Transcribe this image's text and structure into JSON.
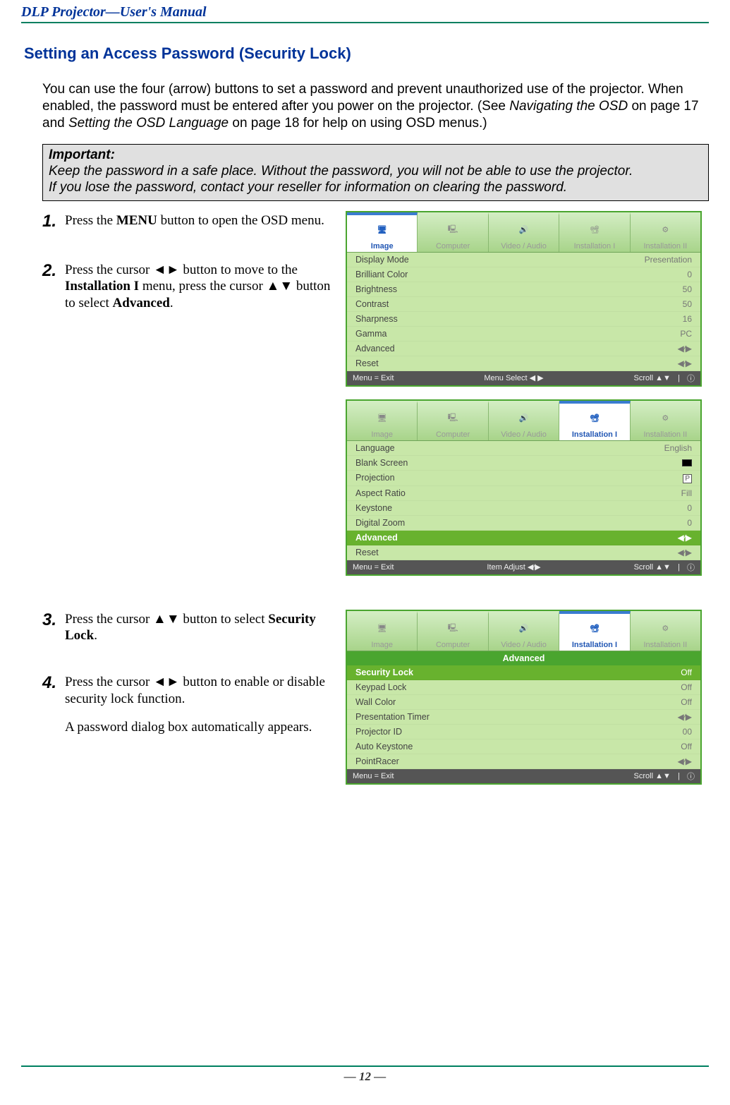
{
  "doc": {
    "header": "DLP Projector—User's Manual",
    "section_heading": "Setting an Access Password (Security Lock)",
    "intro_part1": "You can use the four (arrow) buttons to set a password and prevent unauthorized use of the projector. When enabled, the password must be entered after you power on the projector. (See ",
    "intro_italic1": "Navigating the OSD",
    "intro_part2": " on page 17 and ",
    "intro_italic2": "Setting the OSD Language",
    "intro_part3": " on page 18 for help on using OSD menus.)",
    "note_title": "Important:",
    "note_line1": "Keep the password in a safe place. Without the password, you will not be able to use the projector.",
    "note_line2": "If you lose the password, contact your reseller for information on clearing the password.",
    "steps": {
      "s1_num": "1.",
      "s1_a": "Press the ",
      "s1_b": "MENU",
      "s1_c": " button to open the OSD menu.",
      "s2_num": "2.",
      "s2_a": "Press the cursor ◄► button to move to the ",
      "s2_b": "Installation I",
      "s2_c": " menu, press the cursor ▲▼ button to select ",
      "s2_d": "Advanced",
      "s2_e": ".",
      "s3_num": "3.",
      "s3_a": "Press the cursor ▲▼ button to select ",
      "s3_b": "Security Lock",
      "s3_c": ".",
      "s4_num": "4.",
      "s4_a": "Press the cursor ◄► button to enable or disable security lock function.",
      "s4_b": "A password dialog box automatically appears."
    },
    "page_num": "— 12 —"
  },
  "osd_tabs": {
    "t1": "Image",
    "t2": "Computer",
    "t3": "Video / Audio",
    "t4": "Installation I",
    "t5": "Installation II"
  },
  "osd1": {
    "rows": [
      {
        "label": "Display Mode",
        "value": "Presentation"
      },
      {
        "label": "Brilliant Color",
        "value": "0"
      },
      {
        "label": "Brightness",
        "value": "50"
      },
      {
        "label": "Contrast",
        "value": "50"
      },
      {
        "label": "Sharpness",
        "value": "16"
      },
      {
        "label": "Gamma",
        "value": "PC"
      },
      {
        "label": "Advanced",
        "value": "◀∕▶"
      },
      {
        "label": "Reset",
        "value": "◀∕▶"
      }
    ],
    "foot_left": "Menu = Exit",
    "foot_mid": "Menu Select ◀ ▶",
    "foot_right": "Scroll ▲▼"
  },
  "osd2": {
    "rows": [
      {
        "label": "Language",
        "value": "English"
      },
      {
        "label": "Blank Screen",
        "value": "swatch"
      },
      {
        "label": "Projection",
        "value": "P"
      },
      {
        "label": "Aspect Ratio",
        "value": "Fill"
      },
      {
        "label": "Keystone",
        "value": "0"
      },
      {
        "label": "Digital Zoom",
        "value": "0"
      },
      {
        "label": "Advanced",
        "value": "◀∕▶",
        "highlight": true
      },
      {
        "label": "Reset",
        "value": "◀∕▶"
      }
    ],
    "foot_left": "Menu = Exit",
    "foot_mid": "Item Adjust ◀∕▶",
    "foot_right": "Scroll ▲▼"
  },
  "osd3": {
    "submenu": "Advanced",
    "rows": [
      {
        "label": "Security Lock",
        "value": "Off",
        "highlight": true
      },
      {
        "label": "Keypad Lock",
        "value": "Off"
      },
      {
        "label": "Wall Color",
        "value": "Off"
      },
      {
        "label": "Presentation Timer",
        "value": "◀∕▶"
      },
      {
        "label": "Projector ID",
        "value": "00"
      },
      {
        "label": "Auto Keystone",
        "value": "Off"
      },
      {
        "label": "PointRacer",
        "value": "◀∕▶"
      }
    ],
    "foot_left": "Menu = Exit",
    "foot_mid": "",
    "foot_right": "Scroll ▲▼"
  }
}
